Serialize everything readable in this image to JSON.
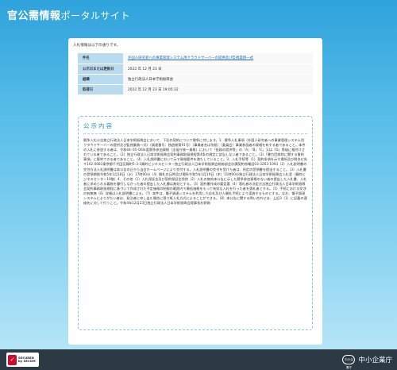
{
  "header": {
    "title": "官公需情報",
    "title_sub": "ポータルサイト"
  },
  "intro": "入札情報は以下の通りです。",
  "info": [
    {
      "label": "件名",
      "value": "外国人研究者への事業管理システム用クラウドサーバーの提供及び監視業務一式",
      "link": true
    },
    {
      "label": "公示日または更新日",
      "value": "2022 年 12 月 23 日"
    },
    {
      "label": "組織",
      "value": "独立行政法人日本学術振興会"
    },
    {
      "label": "取得日",
      "value": "2022 年 12 月 23 日 19:05:32"
    }
  ],
  "notice": {
    "title": "公示内容",
    "body": "競争入札公告独立行政法人日本学術振興会において、下記の契約について競争に付します。1．競争入札事項（外国人研究者への事業管理システム用クラウドサーバーの提供及び監視業務一式）（調達番号：独造総第91号）（事業者名は別紙）（委員会）事業参画者の資格を有する者であること。本件の入札に参加する者は、令和04･05･06年度競争参加資格（全省庁統一資格）において「役務の提供等」の「A」「B」「C」又は「D」等級に格付けされている者であること。（2）独立行政法人日本学術振興会契約事務取扱規程第4条の規定に該当しない者であること。（3）「暴力団排除に関する誓約事項」に誓約できる者であること。（4）入札説明書において示す資格要件を満たしていること。3．入札手続等（1）契約条項を示す場所及び問合せ先〒102-0083東京都千代田区麹町5-3-1麹町ビジネスセンター独立行政法人日本学術振興会総務部会計課契約係電話03-3263-1093（2）入札説明書の交付方法入札説明書は本公告の日から当会ホームページにより交付する。入札説明書の交付を受けた者は、所定の受領書を提出すること。（3）入札書の受領期限令和5年1月18日（水）17時00分（4）開札の日時及び場所令和5年1月19日（木）11時00分独立行政法人日本学術振興会入札室（麹町ビジネスセンター10階）4．その他（1）入札保証金及び契約保証金免除（2）入札の無効本公告に示した競争参加資格のない者の提出した入札書、入札者に求められる義務を履行しなかった者の提出した入札書は無効とする。（3）契約書作成の要否要（4）落札者の決定方法独立行政法人日本学術振興会契約事務取扱規程に基づいて作成された予定価格の制限の範囲内で最低価格をもって有効な入札を行った者を落札者とする。（5）手続における交渉の有無無（6）詳細は入札説明書による。（7）本件は、電子調達システムを利用した応札及び入開札手続により実施するものとする。なお、電子調達システムによりがたい者は、発注者に申し出た場合に限り紙入札方式によることができる。（8）本公告に関する問い合わせは、上記3（1）に記載の連絡先に対して行うこと。令和4年12月23日独立行政法人日本学術振興会理事長杉野剛"
  },
  "footer": {
    "seal_text_1": "SECURED",
    "seal_text_2": "by SECOM",
    "agency_mark": "中小企業庁",
    "agency_name": "中小企業庁"
  }
}
